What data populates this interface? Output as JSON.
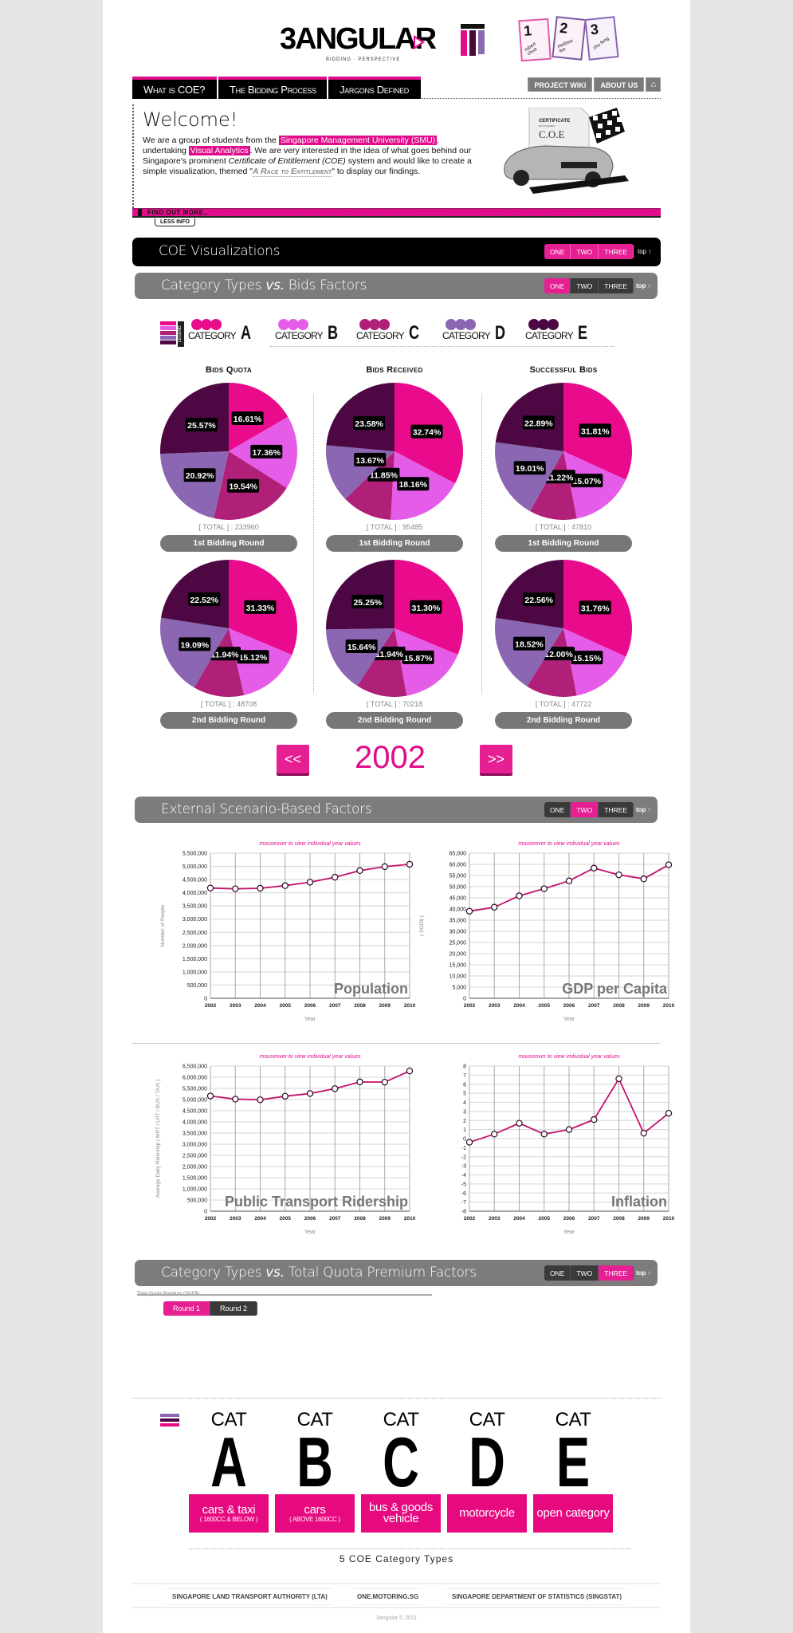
{
  "header": {
    "logo_text": "3ANGULAR",
    "logo_subtitle": "BIDDING · PERSPECTIVE",
    "team_cards": [
      {
        "number": "1",
        "name": "robert chua"
      },
      {
        "number": "2",
        "name": "melissa lee"
      },
      {
        "number": "3",
        "name": "zhu feng"
      }
    ]
  },
  "nav": {
    "tabs": [
      "What is COE?",
      "The Bidding Process",
      "Jargons Defined"
    ],
    "right": [
      "PROJECT WIKI",
      "ABOUT US"
    ],
    "home_icon": "⌂"
  },
  "welcome": {
    "title": "Welcome!",
    "p1": "We are a group of students from the ",
    "smu": "Singapore Management University (SMU)",
    "p2": ", undertaking ",
    "va": "Visual Analytics",
    "p3": ". We are very interested in the idea of what goes behind our Singapore's prominent ",
    "coe": "Certificate of Entitlement (COE)",
    "p4": " system and would like to create a simple visualization, themed \"",
    "race": "A Race to Entitlement",
    "p5": "\" to display our findings.",
    "cert_title": "CERTIFICATE",
    "cert_sub": "ENTITLEMENT",
    "cert_coe": "C.O.E",
    "find_more": "FIND OUT MORE..",
    "less_info": "LESS INFO"
  },
  "sections": {
    "main": {
      "title": "COE Visualizations",
      "buttons": [
        "ONE",
        "TWO",
        "THREE"
      ],
      "top": "top ↑"
    },
    "s1": {
      "title_a": "Category Types ",
      "vs": "vs.",
      "title_b": " Bids Factors",
      "buttons": [
        "ONE",
        "TWO",
        "THREE"
      ],
      "active": 0,
      "top": "top ↑"
    },
    "s2": {
      "title": "External Scenario-Based Factors",
      "buttons": [
        "ONE",
        "TWO",
        "THREE"
      ],
      "active": 1,
      "top": "top ↑"
    },
    "s3": {
      "title_a": "Category Types ",
      "vs": "vs.",
      "title_b": " Total Quota Premium Factors",
      "buttons": [
        "ONE",
        "TWO",
        "THREE"
      ],
      "active": 2,
      "top": "top ↑"
    }
  },
  "legend": {
    "label": "LEGEND",
    "word": "CATEGORY",
    "categories": [
      {
        "letter": "A",
        "color": "#ea0a8c"
      },
      {
        "letter": "B",
        "color": "#e55ce8"
      },
      {
        "letter": "C",
        "color": "#b01f78"
      },
      {
        "letter": "D",
        "color": "#8a66b3"
      },
      {
        "letter": "E",
        "color": "#4d0843"
      }
    ]
  },
  "pies": {
    "titles": [
      "Bids Quota",
      "Bids Received",
      "Successful Bids"
    ],
    "total_prefix": "[ TOTAL ] : ",
    "round_labels": [
      "1st Bidding Round",
      "2nd Bidding Round"
    ]
  },
  "year_nav": {
    "prev": "<<",
    "year": "2002",
    "next": ">>"
  },
  "line_charts": {
    "mouseover_hint": "mouseover to view individual year values"
  },
  "round_toggle": {
    "caption": "Total Quota Premium (SGD$)",
    "buttons": [
      "Round 1",
      "Round 2"
    ],
    "active": 0
  },
  "cat_types": {
    "cat_label": "CAT",
    "items": [
      {
        "letter": "A",
        "name": "cars & taxi",
        "sub": "( 1600CC & BELOW )"
      },
      {
        "letter": "B",
        "name": "cars",
        "sub": "( ABOVE 1600CC )"
      },
      {
        "letter": "C",
        "name": "bus & goods vehicle",
        "sub": ""
      },
      {
        "letter": "D",
        "name": "motorcycle",
        "sub": ""
      },
      {
        "letter": "E",
        "name": "open category",
        "sub": ""
      }
    ],
    "caption": "5 COE Category Types"
  },
  "footer": {
    "links": [
      "SINGAPORE LAND TRANSPORT AUTHORITY (LTA)",
      "ONE.MOTORING.SG",
      "SINGAPORE DEPARTMENT OF STATISTICS (SINGSTAT)"
    ],
    "copyright": "3angular © 2011"
  },
  "chart_data": [
    {
      "type": "pie",
      "title": "Bids Quota",
      "subtitle": "1st Bidding Round",
      "total": "233960",
      "categories": [
        "A",
        "B",
        "C",
        "D",
        "E"
      ],
      "values": [
        16.61,
        17.36,
        19.54,
        20.92,
        25.57
      ]
    },
    {
      "type": "pie",
      "title": "Bids Received",
      "subtitle": "1st Bidding Round",
      "total": "95485",
      "categories": [
        "A",
        "B",
        "C",
        "D",
        "E"
      ],
      "values": [
        32.74,
        18.16,
        11.85,
        13.67,
        23.58
      ]
    },
    {
      "type": "pie",
      "title": "Successful Bids",
      "subtitle": "1st Bidding Round",
      "total": "47810",
      "categories": [
        "A",
        "B",
        "C",
        "D",
        "E"
      ],
      "values": [
        31.81,
        15.07,
        11.22,
        19.01,
        22.89
      ]
    },
    {
      "type": "pie",
      "title": "Bids Quota",
      "subtitle": "2nd Bidding Round",
      "total": "48708",
      "categories": [
        "A",
        "B",
        "C",
        "D",
        "E"
      ],
      "values": [
        31.33,
        15.12,
        11.94,
        19.09,
        22.52
      ]
    },
    {
      "type": "pie",
      "title": "Bids Received",
      "subtitle": "2nd Bidding Round",
      "total": "70218",
      "categories": [
        "A",
        "B",
        "C",
        "D",
        "E"
      ],
      "values": [
        31.3,
        15.87,
        11.94,
        15.64,
        25.25
      ]
    },
    {
      "type": "pie",
      "title": "Successful Bids",
      "subtitle": "2nd Bidding Round",
      "total": "47722",
      "categories": [
        "A",
        "B",
        "C",
        "D",
        "E"
      ],
      "values": [
        31.76,
        15.15,
        12.0,
        18.52,
        22.56
      ]
    },
    {
      "type": "line",
      "title": "Population",
      "xlabel": "Year",
      "ylabel": "Number of People",
      "x": [
        "2002",
        "2003",
        "2004",
        "2005",
        "2006",
        "2007",
        "2008",
        "2009",
        "2010"
      ],
      "values": [
        4180000,
        4150000,
        4170000,
        4270000,
        4400000,
        4590000,
        4840000,
        4990000,
        5080000
      ],
      "ylim": [
        0,
        5500000
      ],
      "ytick_step": 500000,
      "yticks": [
        "0",
        "500,000",
        "1,000,000",
        "1,500,000",
        "2,000,000",
        "2,500,000",
        "3,000,000",
        "3,500,000",
        "4,000,000",
        "4,500,000",
        "5,000,000",
        "5,500,000"
      ],
      "grid": true
    },
    {
      "type": "line",
      "title": "GDP per Capita",
      "xlabel": "Year",
      "ylabel": "( SGD$ )",
      "x": [
        "2002",
        "2003",
        "2004",
        "2005",
        "2006",
        "2007",
        "2008",
        "2009",
        "2010"
      ],
      "values": [
        39000,
        40800,
        45900,
        49100,
        52600,
        58300,
        55300,
        53500,
        59800
      ],
      "ylim": [
        0,
        65000
      ],
      "ytick_step": 5000,
      "yticks": [
        "0",
        "5,000",
        "10,000",
        "15,000",
        "20,000",
        "25,000",
        "30,000",
        "35,000",
        "40,000",
        "45,000",
        "50,000",
        "55,000",
        "60,000",
        "65,000"
      ],
      "grid": true
    },
    {
      "type": "line",
      "title": "Public Transport Ridership",
      "xlabel": "Year",
      "ylabel": "Average Daily Ridership ( MRT / LRT / BUS / TAXI )",
      "x": [
        "2002",
        "2003",
        "2004",
        "2005",
        "2006",
        "2007",
        "2008",
        "2009",
        "2010"
      ],
      "values": [
        5160000,
        5020000,
        4990000,
        5150000,
        5270000,
        5490000,
        5790000,
        5780000,
        6280000
      ],
      "ylim": [
        0,
        6500000
      ],
      "ytick_step": 500000,
      "yticks": [
        "0",
        "500,000",
        "1,000,000",
        "1,500,000",
        "2,000,000",
        "2,500,000",
        "3,000,000",
        "3,500,000",
        "4,000,000",
        "4,500,000",
        "5,000,000",
        "5,500,000",
        "6,000,000",
        "6,500,000"
      ],
      "grid": true
    },
    {
      "type": "line",
      "title": "Inflation",
      "xlabel": "Year",
      "ylabel": "",
      "x": [
        "2002",
        "2003",
        "2004",
        "2005",
        "2006",
        "2007",
        "2008",
        "2009",
        "2010"
      ],
      "values": [
        -0.4,
        0.5,
        1.7,
        0.5,
        1.0,
        2.1,
        6.6,
        0.6,
        2.8
      ],
      "ylim": [
        -8,
        8
      ],
      "ytick_step": 1,
      "yticks": [
        "-8",
        "-7",
        "-6",
        "-5",
        "-4",
        "-3",
        "-2",
        "-1",
        "0",
        "1",
        "2",
        "3",
        "4",
        "5",
        "6",
        "7",
        "8"
      ],
      "grid": true
    }
  ]
}
